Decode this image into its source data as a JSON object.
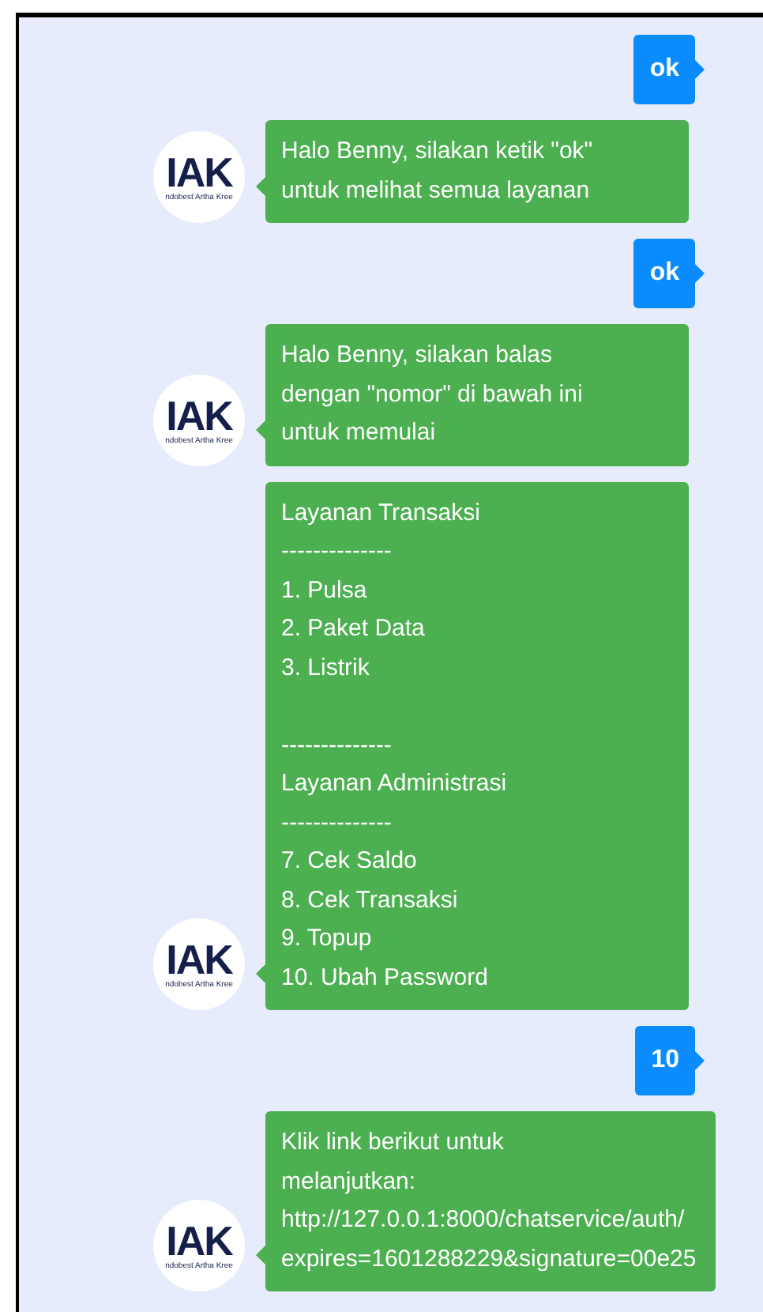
{
  "messages": [
    {
      "kind": "user",
      "text": "ok"
    },
    {
      "kind": "bot",
      "logo": {
        "mark": "IAK",
        "caption": "ndobest Artha Kree"
      },
      "text": "Halo Benny, silakan ketik \"ok\"\nuntuk melihat semua layanan"
    },
    {
      "kind": "user",
      "text": "ok"
    },
    {
      "kind": "bot",
      "logo": {
        "mark": "IAK",
        "caption": "ndobest Artha Kree"
      },
      "text": "Halo Benny, silakan balas\ndengan \"nomor\" di bawah ini\nuntuk memulai"
    },
    {
      "kind": "bot",
      "logo": {
        "mark": "IAK",
        "caption": "ndobest Artha Kree"
      },
      "text": "Layanan Transaksi\n--------------\n1. Pulsa\n2. Paket Data\n3. Listrik\n\n--------------\nLayanan Administrasi\n--------------\n7. Cek Saldo\n8. Cek Transaksi\n9. Topup\n10. Ubah Password"
    },
    {
      "kind": "user",
      "text": "10"
    },
    {
      "kind": "bot",
      "logo": {
        "mark": "IAK",
        "caption": "ndobest Artha Kree"
      },
      "text": "Klik link berikut untuk\nmelanjutkan:\nhttp://127.0.0.1:8000/chatservice/auth/\nexpires=1601288229&signature=00e25"
    }
  ]
}
